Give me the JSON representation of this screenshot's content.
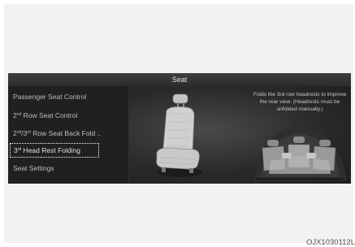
{
  "screen": {
    "title": "Seat",
    "menu": [
      {
        "text": "Passenger Seat Control",
        "selected": false
      },
      {
        "prefix": "2",
        "sup": "nd",
        "suffix": " Row Seat Control",
        "selected": false
      },
      {
        "prefix": "2",
        "sup": "nd",
        "mid": "/3",
        "sup2": "rd",
        "suffix": " Row Seat Back Fold ..",
        "selected": false
      },
      {
        "prefix": "3",
        "sup": "rd",
        "suffix": " Head Rest Folding",
        "selected": true
      },
      {
        "text": "Seat Settings",
        "selected": false
      }
    ],
    "description": "Folds the 3rd row headrests to improve the rear view. (Headrests must be unfolded manually.)"
  },
  "figure_code": "OJX1030112L"
}
